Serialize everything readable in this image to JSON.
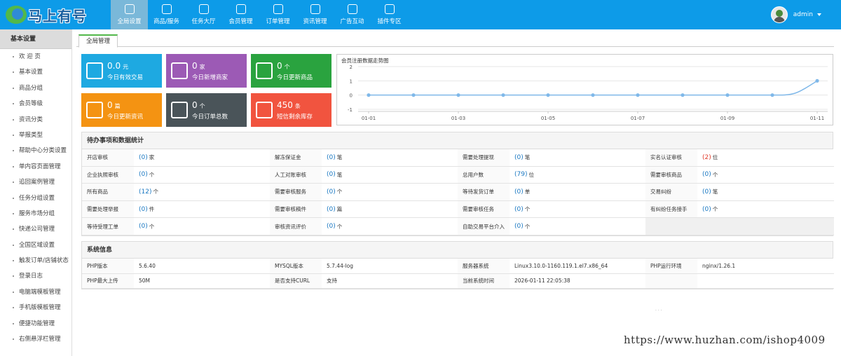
{
  "app": {
    "logo_text": "马上有号",
    "user_name": "admin"
  },
  "nav": [
    {
      "label": "全局设置",
      "icon": "grid-icon"
    },
    {
      "label": "商品/服务",
      "icon": "user-icon"
    },
    {
      "label": "任务大厅",
      "icon": "copy-icon"
    },
    {
      "label": "会员管理",
      "icon": "document-icon"
    },
    {
      "label": "订单管理",
      "icon": "camera-icon"
    },
    {
      "label": "资讯管理",
      "icon": "calendar-icon"
    },
    {
      "label": "广告互动",
      "icon": "gear-icon"
    },
    {
      "label": "插件专区",
      "icon": "bag-icon"
    }
  ],
  "sidebar": {
    "title": "基本设置",
    "items": [
      "欢 迎 页",
      "基本设置",
      "商品分组",
      "会员等级",
      "资讯分类",
      "举报类型",
      "帮助中心分类设置",
      "单内容页面管理",
      "追回案例管理",
      "任务分组设置",
      "服务市场分组",
      "快递公司管理",
      "全国区域设置",
      "触发订单/店铺状态",
      "登录日志",
      "电脑端模板管理",
      "手机版模板管理",
      "便捷功能管理",
      "右侧悬浮栏管理"
    ]
  },
  "tab": {
    "label": "全局管理"
  },
  "tiles": [
    {
      "value": "0.0",
      "unit": "元",
      "label": "今日有效交易",
      "color": "#1ea9e1",
      "icon": "yen-icon"
    },
    {
      "value": "0",
      "unit": "家",
      "label": "今日新增商家",
      "color": "#9c5ab5",
      "icon": "clipboard-icon"
    },
    {
      "value": "0",
      "unit": "个",
      "label": "今日更新商品",
      "color": "#2aa33f",
      "icon": "report-clock-icon"
    },
    {
      "value": "0",
      "unit": "篇",
      "label": "今日更新资讯",
      "color": "#f49312",
      "icon": "envelope-icon"
    },
    {
      "value": "0",
      "unit": "个",
      "label": "今日订单总数",
      "color": "#4a5459",
      "icon": "users-icon"
    },
    {
      "value": "450",
      "unit": "条",
      "label": "短信剩余库存",
      "color": "#f1543f",
      "icon": "bell-icon"
    }
  ],
  "chart_data": {
    "type": "line",
    "title": "会员注册数据走势图",
    "x": [
      "01-01",
      "01-02",
      "01-03",
      "01-04",
      "01-05",
      "01-06",
      "01-07",
      "01-08",
      "01-09",
      "01-10",
      "01-11"
    ],
    "x_tick_labels": [
      "01-01",
      "01-03",
      "01-05",
      "01-07",
      "01-09",
      "01-11"
    ],
    "series": [
      {
        "values": [
          0,
          0,
          0,
          0,
          0,
          0,
          0,
          0,
          0,
          0,
          1
        ]
      }
    ],
    "ylim": [
      -1,
      2
    ],
    "y_ticks": [
      2,
      1,
      0,
      -1
    ],
    "grid": true,
    "color": "#7fb8e9"
  },
  "pending": {
    "title": "待办事项和数据统计",
    "rows": [
      [
        {
          "label": "开店审核",
          "count": "(0)",
          "unit": "家"
        },
        {
          "label": "解冻保证金",
          "count": "(0)",
          "unit": "笔"
        },
        {
          "label": "需要处理提现",
          "count": "(0)",
          "unit": "笔"
        },
        {
          "label": "实名认证审核",
          "count": "(2)",
          "unit": "位",
          "red": true
        }
      ],
      [
        {
          "label": "企业执照审核",
          "count": "(0)",
          "unit": "个"
        },
        {
          "label": "人工对账审核",
          "count": "(0)",
          "unit": "笔"
        },
        {
          "label": "总用户数",
          "count": "(79)",
          "unit": "位"
        },
        {
          "label": "需要审核商品",
          "count": "(0)",
          "unit": "个"
        }
      ],
      [
        {
          "label": "所有商品",
          "count": "(12)",
          "unit": "个"
        },
        {
          "label": "需要审核服务",
          "count": "(0)",
          "unit": "个"
        },
        {
          "label": "等待发货订单",
          "count": "(0)",
          "unit": "单"
        },
        {
          "label": "交易纠纷",
          "count": "(0)",
          "unit": "笔"
        }
      ],
      [
        {
          "label": "需要处理举报",
          "count": "(0)",
          "unit": "件"
        },
        {
          "label": "需要审核稿件",
          "count": "(0)",
          "unit": "篇"
        },
        {
          "label": "需要审核任务",
          "count": "(0)",
          "unit": "个"
        },
        {
          "label": "有纠纷任务接手",
          "count": "(0)",
          "unit": "个"
        }
      ],
      [
        {
          "label": "等待受理工单",
          "count": "(0)",
          "unit": "个"
        },
        {
          "label": "审核资讯评价",
          "count": "(0)",
          "unit": "个"
        },
        {
          "label": "自助交易平台介入",
          "count": "(0)",
          "unit": "个"
        }
      ]
    ]
  },
  "system": {
    "title": "系统信息",
    "rows": [
      [
        {
          "label": "PHP版本",
          "value": "5.6.40"
        },
        {
          "label": "MYSQL版本",
          "value": "5.7.44-log"
        },
        {
          "label": "服务器系统",
          "value": "Linux3.10.0-1160.119.1.el7.x86_64"
        },
        {
          "label": "PHP运行环境",
          "value": "nginx/1.26.1"
        }
      ],
      [
        {
          "label": "PHP最大上传",
          "value": "50M"
        },
        {
          "label": "是否支持CURL",
          "value": "支持"
        },
        {
          "label": "当前系统时间",
          "value": "2026-01-11 22:05:38"
        },
        {
          "label": "",
          "value": ""
        }
      ]
    ]
  },
  "footer": {
    "dots": ". . .",
    "watermark": "https://www.huzhan.com/ishop4009"
  }
}
